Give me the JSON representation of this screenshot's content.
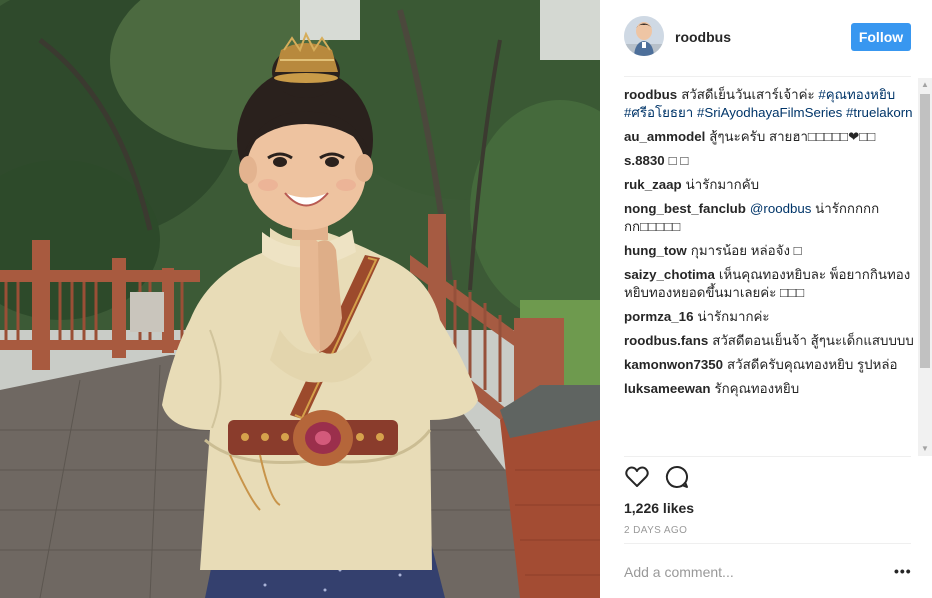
{
  "post": {
    "username": "roodbus",
    "follow_label": "Follow",
    "caption": {
      "user": "roodbus",
      "text": "สวัสดีเย็นวันเสาร์เจ้าค่ะ ",
      "tags": [
        "#คุณทองหยิบ",
        "#ศรีอโยธยา",
        "#SriAyodhayaFilmSeries",
        "#truelakorn"
      ]
    },
    "comments": [
      {
        "user": "au_ammodel",
        "text": "สู้ๆนะครับ สายฮา□□□□□❤□□",
        "mention": ""
      },
      {
        "user": "s.8830",
        "text": "□ □",
        "mention": ""
      },
      {
        "user": "ruk_zaap",
        "text": "น่ารักมากคับ",
        "mention": ""
      },
      {
        "user": "nong_best_fanclub",
        "text": " น่ารักกกกกกก□□□□□",
        "mention": "@roodbus"
      },
      {
        "user": "hung_tow",
        "text": "กุมารน้อย หล่อจัง □",
        "mention": ""
      },
      {
        "user": "saizy_chotima",
        "text": "เห็นคุณทองหยิบละ พ็อยากกินทองหยิบทองหยอดขึ้นมาเลยค่ะ □□□",
        "mention": ""
      },
      {
        "user": "pormza_16",
        "text": "น่ารักมากค่ะ",
        "mention": ""
      },
      {
        "user": "roodbus.fans",
        "text": "สวัสดีตอนเย็นจ้า สู้ๆนะเด็กแสบบบบ",
        "mention": ""
      },
      {
        "user": "kamonwon7350",
        "text": "สวัสดีครับคุณทองหยิบ รูปหล่อ",
        "mention": ""
      },
      {
        "user": "luksameewan",
        "text": "รักคุณทองหยิบ",
        "mention": ""
      }
    ],
    "likes": "1,226 likes",
    "time": "2 DAYS AGO",
    "comment_placeholder": "Add a comment...",
    "more_label": "•••",
    "icons": {
      "like": "heart-outline-icon",
      "comment": "speech-bubble-icon",
      "more": "ellipsis-icon"
    },
    "colors": {
      "follow": "#3897f0",
      "hashtag": "#003569",
      "text": "#262626",
      "muted": "#999999"
    }
  }
}
